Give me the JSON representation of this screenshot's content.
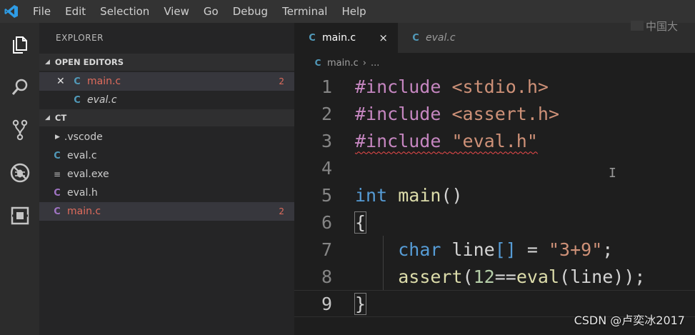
{
  "menubar": {
    "items": [
      "File",
      "Edit",
      "Selection",
      "View",
      "Go",
      "Debug",
      "Terminal",
      "Help"
    ]
  },
  "sidebar": {
    "title": "EXPLORER",
    "open_editors": {
      "header": "OPEN EDITORS",
      "items": [
        {
          "icon": "C",
          "name": "main.c",
          "badge": "2"
        },
        {
          "icon": "C",
          "name": "eval.c"
        }
      ]
    },
    "folder": {
      "header": "CT",
      "items": [
        {
          "icon": "",
          "name": ".vscode"
        },
        {
          "icon": "C",
          "name": "eval.c"
        },
        {
          "icon": "",
          "name": "eval.exe"
        },
        {
          "icon": "C",
          "name": "eval.h"
        },
        {
          "icon": "C",
          "name": "main.c",
          "badge": "2"
        }
      ]
    }
  },
  "tabs": [
    {
      "icon": "C",
      "label": "main.c",
      "close": "×"
    },
    {
      "icon": "C",
      "label": "eval.c"
    }
  ],
  "breadcrumb": {
    "icon": "C",
    "file": "main.c",
    "sep": "›",
    "rest": "..."
  },
  "code": {
    "line_numbers": [
      "1",
      "2",
      "3",
      "4",
      "5",
      "6",
      "7",
      "8",
      "9"
    ],
    "l1": {
      "a": "#include",
      "b": "<stdio.h>"
    },
    "l2": {
      "a": "#include",
      "b": "<assert.h>"
    },
    "l3": {
      "a": "#include",
      "b": "\"eval.h\""
    },
    "l5": {
      "a": "int",
      "b": "main",
      "c": "()"
    },
    "l6": {
      "a": "{"
    },
    "l7": {
      "a": "char",
      "b": "line",
      "c": "[]",
      "d": " = ",
      "e": "\"3+9\"",
      "f": ";"
    },
    "l8": {
      "a": "assert",
      "b": "(",
      "c": "12",
      "d": "==",
      "e": "eval",
      "f": "(line));"
    },
    "l9": {
      "a": "}"
    }
  },
  "overlay": {
    "watermark": "CSDN @卢奕冰2017",
    "corner_text": "中国大",
    "cursor_glyph": "I"
  },
  "colors": {
    "menubar": "#333333",
    "activitybar": "#2c2c2c",
    "sidebar": "#252526",
    "editor": "#1e1e1e",
    "c_file_icon": "#519aba",
    "error": "#e06c5d",
    "preprocessor": "#c586c0",
    "string": "#ce9178",
    "keyword": "#569cd6",
    "function": "#dcdcaa",
    "number": "#b5cea8"
  },
  "icons": [
    "vscode-logo-icon",
    "files-icon",
    "search-icon",
    "source-control-icon",
    "debug-icon",
    "extensions-icon"
  ]
}
